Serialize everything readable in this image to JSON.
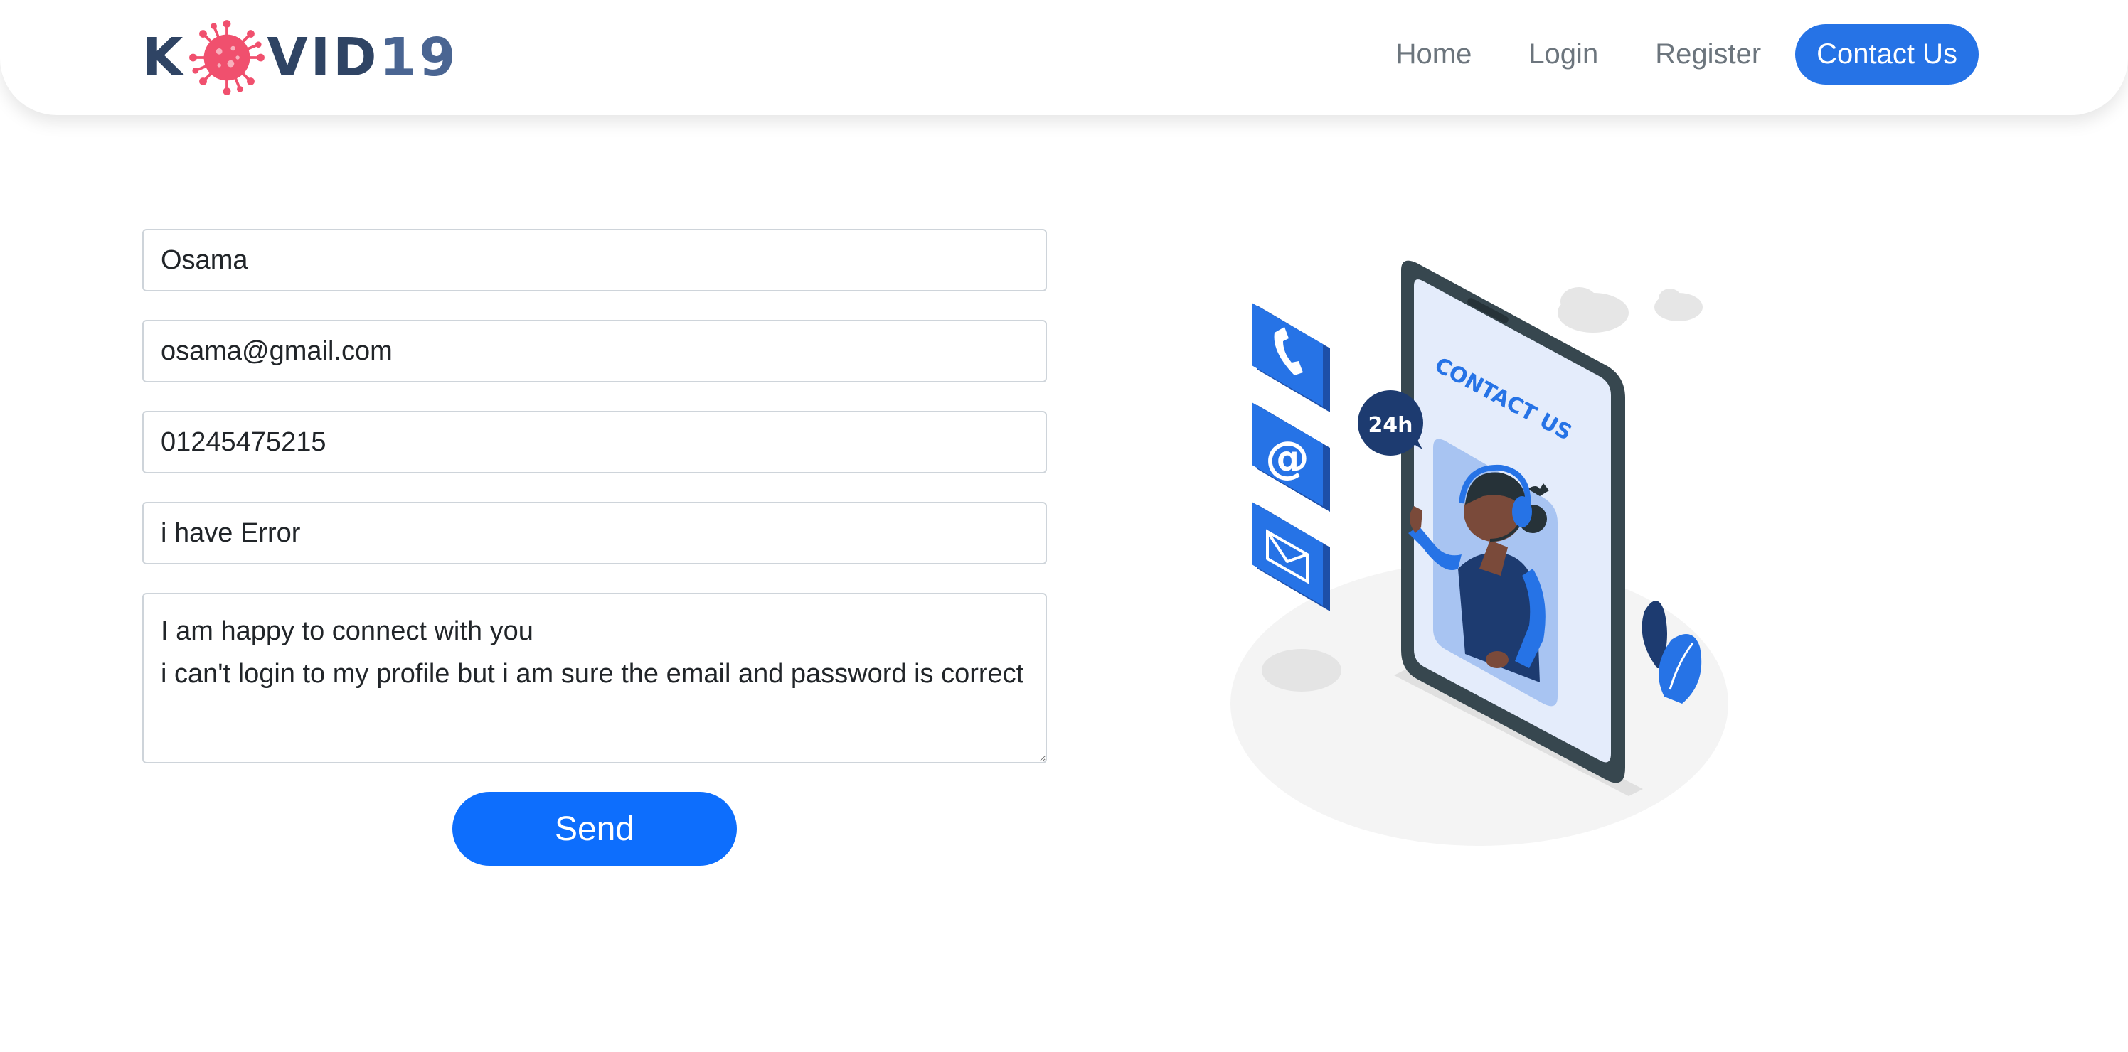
{
  "brand": {
    "prefix": "K",
    "suffix": "VID",
    "number": "19",
    "virus_icon": "virus-icon",
    "colors": {
      "text": "#2f4464",
      "virus": "#f0506e"
    }
  },
  "nav": {
    "items": [
      {
        "label": "Home"
      },
      {
        "label": "Login"
      },
      {
        "label": "Register"
      },
      {
        "label": "Contact Us",
        "active": true
      }
    ],
    "accent": "#2673e6"
  },
  "form": {
    "name": {
      "value": "Osama"
    },
    "email": {
      "value": "osama@gmail.com"
    },
    "phone": {
      "value": "01245475215"
    },
    "subject": {
      "value": "i have Error"
    },
    "message": {
      "value": "I am happy to connect with you\ni can't login to my profile but i am sure the email and password is correct"
    },
    "send_label": "Send",
    "button_color": "#0d6efd"
  },
  "illustration": {
    "screen_title": "CONTACT US",
    "badge": "24h",
    "icons": [
      "phone-icon",
      "at-sign-icon",
      "envelope-icon"
    ]
  }
}
